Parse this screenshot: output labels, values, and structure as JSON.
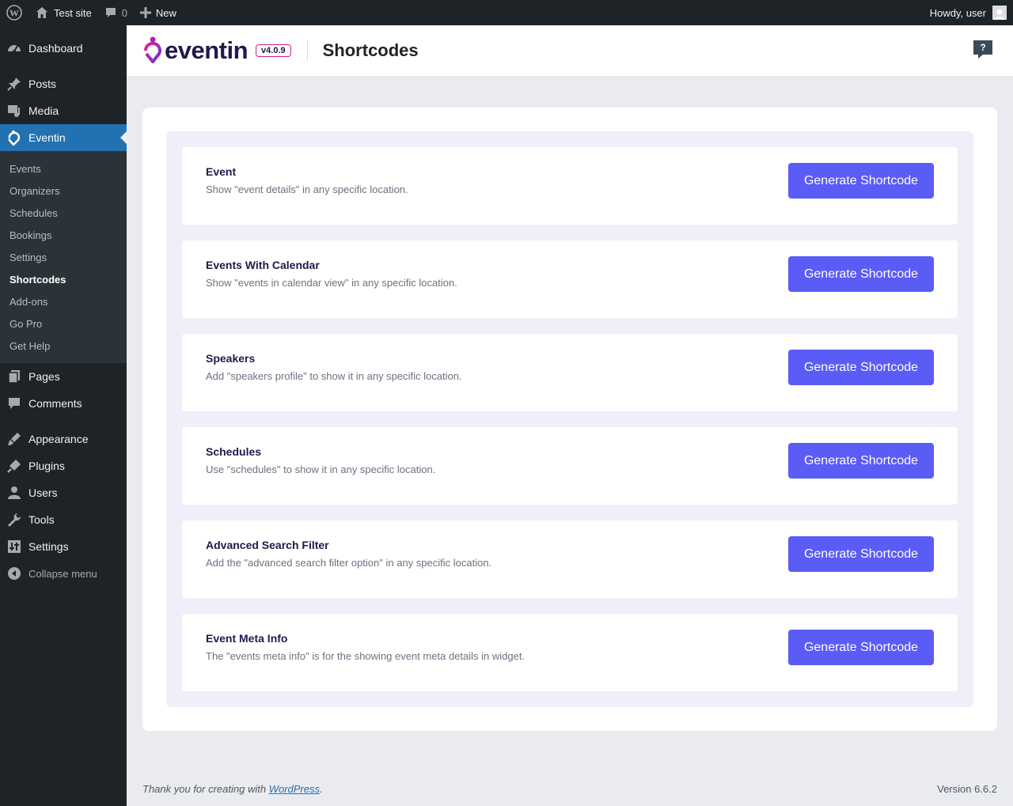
{
  "adminbar": {
    "site_name": "Test site",
    "comments_count": "0",
    "new_label": "New",
    "greeting": "Howdy, user"
  },
  "sidebar": {
    "top_items": [
      {
        "label": "Dashboard",
        "icon": "dashboard-icon"
      },
      {
        "label": "Posts",
        "icon": "pin-icon"
      },
      {
        "label": "Media",
        "icon": "media-icon"
      },
      {
        "label": "Eventin",
        "icon": "eventin-icon"
      }
    ],
    "submenu": [
      "Events",
      "Organizers",
      "Schedules",
      "Bookings",
      "Settings",
      "Shortcodes",
      "Add-ons",
      "Go Pro",
      "Get Help"
    ],
    "bottom_items": [
      {
        "label": "Pages",
        "icon": "pages-icon"
      },
      {
        "label": "Comments",
        "icon": "comments-icon"
      },
      {
        "label": "Appearance",
        "icon": "brush-icon"
      },
      {
        "label": "Plugins",
        "icon": "plugin-icon"
      },
      {
        "label": "Users",
        "icon": "users-icon"
      },
      {
        "label": "Tools",
        "icon": "wrench-icon"
      },
      {
        "label": "Settings",
        "icon": "settings-icon"
      }
    ],
    "collapse_label": "Collapse menu"
  },
  "header": {
    "logo_text": "eventin",
    "version": "v4.0.9",
    "page_title": "Shortcodes"
  },
  "cards": [
    {
      "title": "Event",
      "description": "Show \"event details\" in any specific location.",
      "button": "Generate Shortcode"
    },
    {
      "title": "Events With Calendar",
      "description": "Show \"events in calendar view\" in any specific location.",
      "button": "Generate Shortcode"
    },
    {
      "title": "Speakers",
      "description": "Add \"speakers profile\" to show it in any specific location.",
      "button": "Generate Shortcode"
    },
    {
      "title": "Schedules",
      "description": "Use \"schedules\" to show it in any specific location.",
      "button": "Generate Shortcode"
    },
    {
      "title": "Advanced Search Filter",
      "description": "Add the \"advanced search filter option\" in any specific location.",
      "button": "Generate Shortcode"
    },
    {
      "title": "Event Meta Info",
      "description": "The \"events meta info\" is for the showing event meta details in widget.",
      "button": "Generate Shortcode"
    }
  ],
  "footer": {
    "thanks_prefix": "Thank you for creating with ",
    "wp_link": "WordPress",
    "thanks_suffix": ".",
    "version": "Version 6.6.2"
  },
  "colors": {
    "primary_button": "#5b5bf6",
    "admin_dark": "#1d2327",
    "active_menu": "#2271b1"
  }
}
